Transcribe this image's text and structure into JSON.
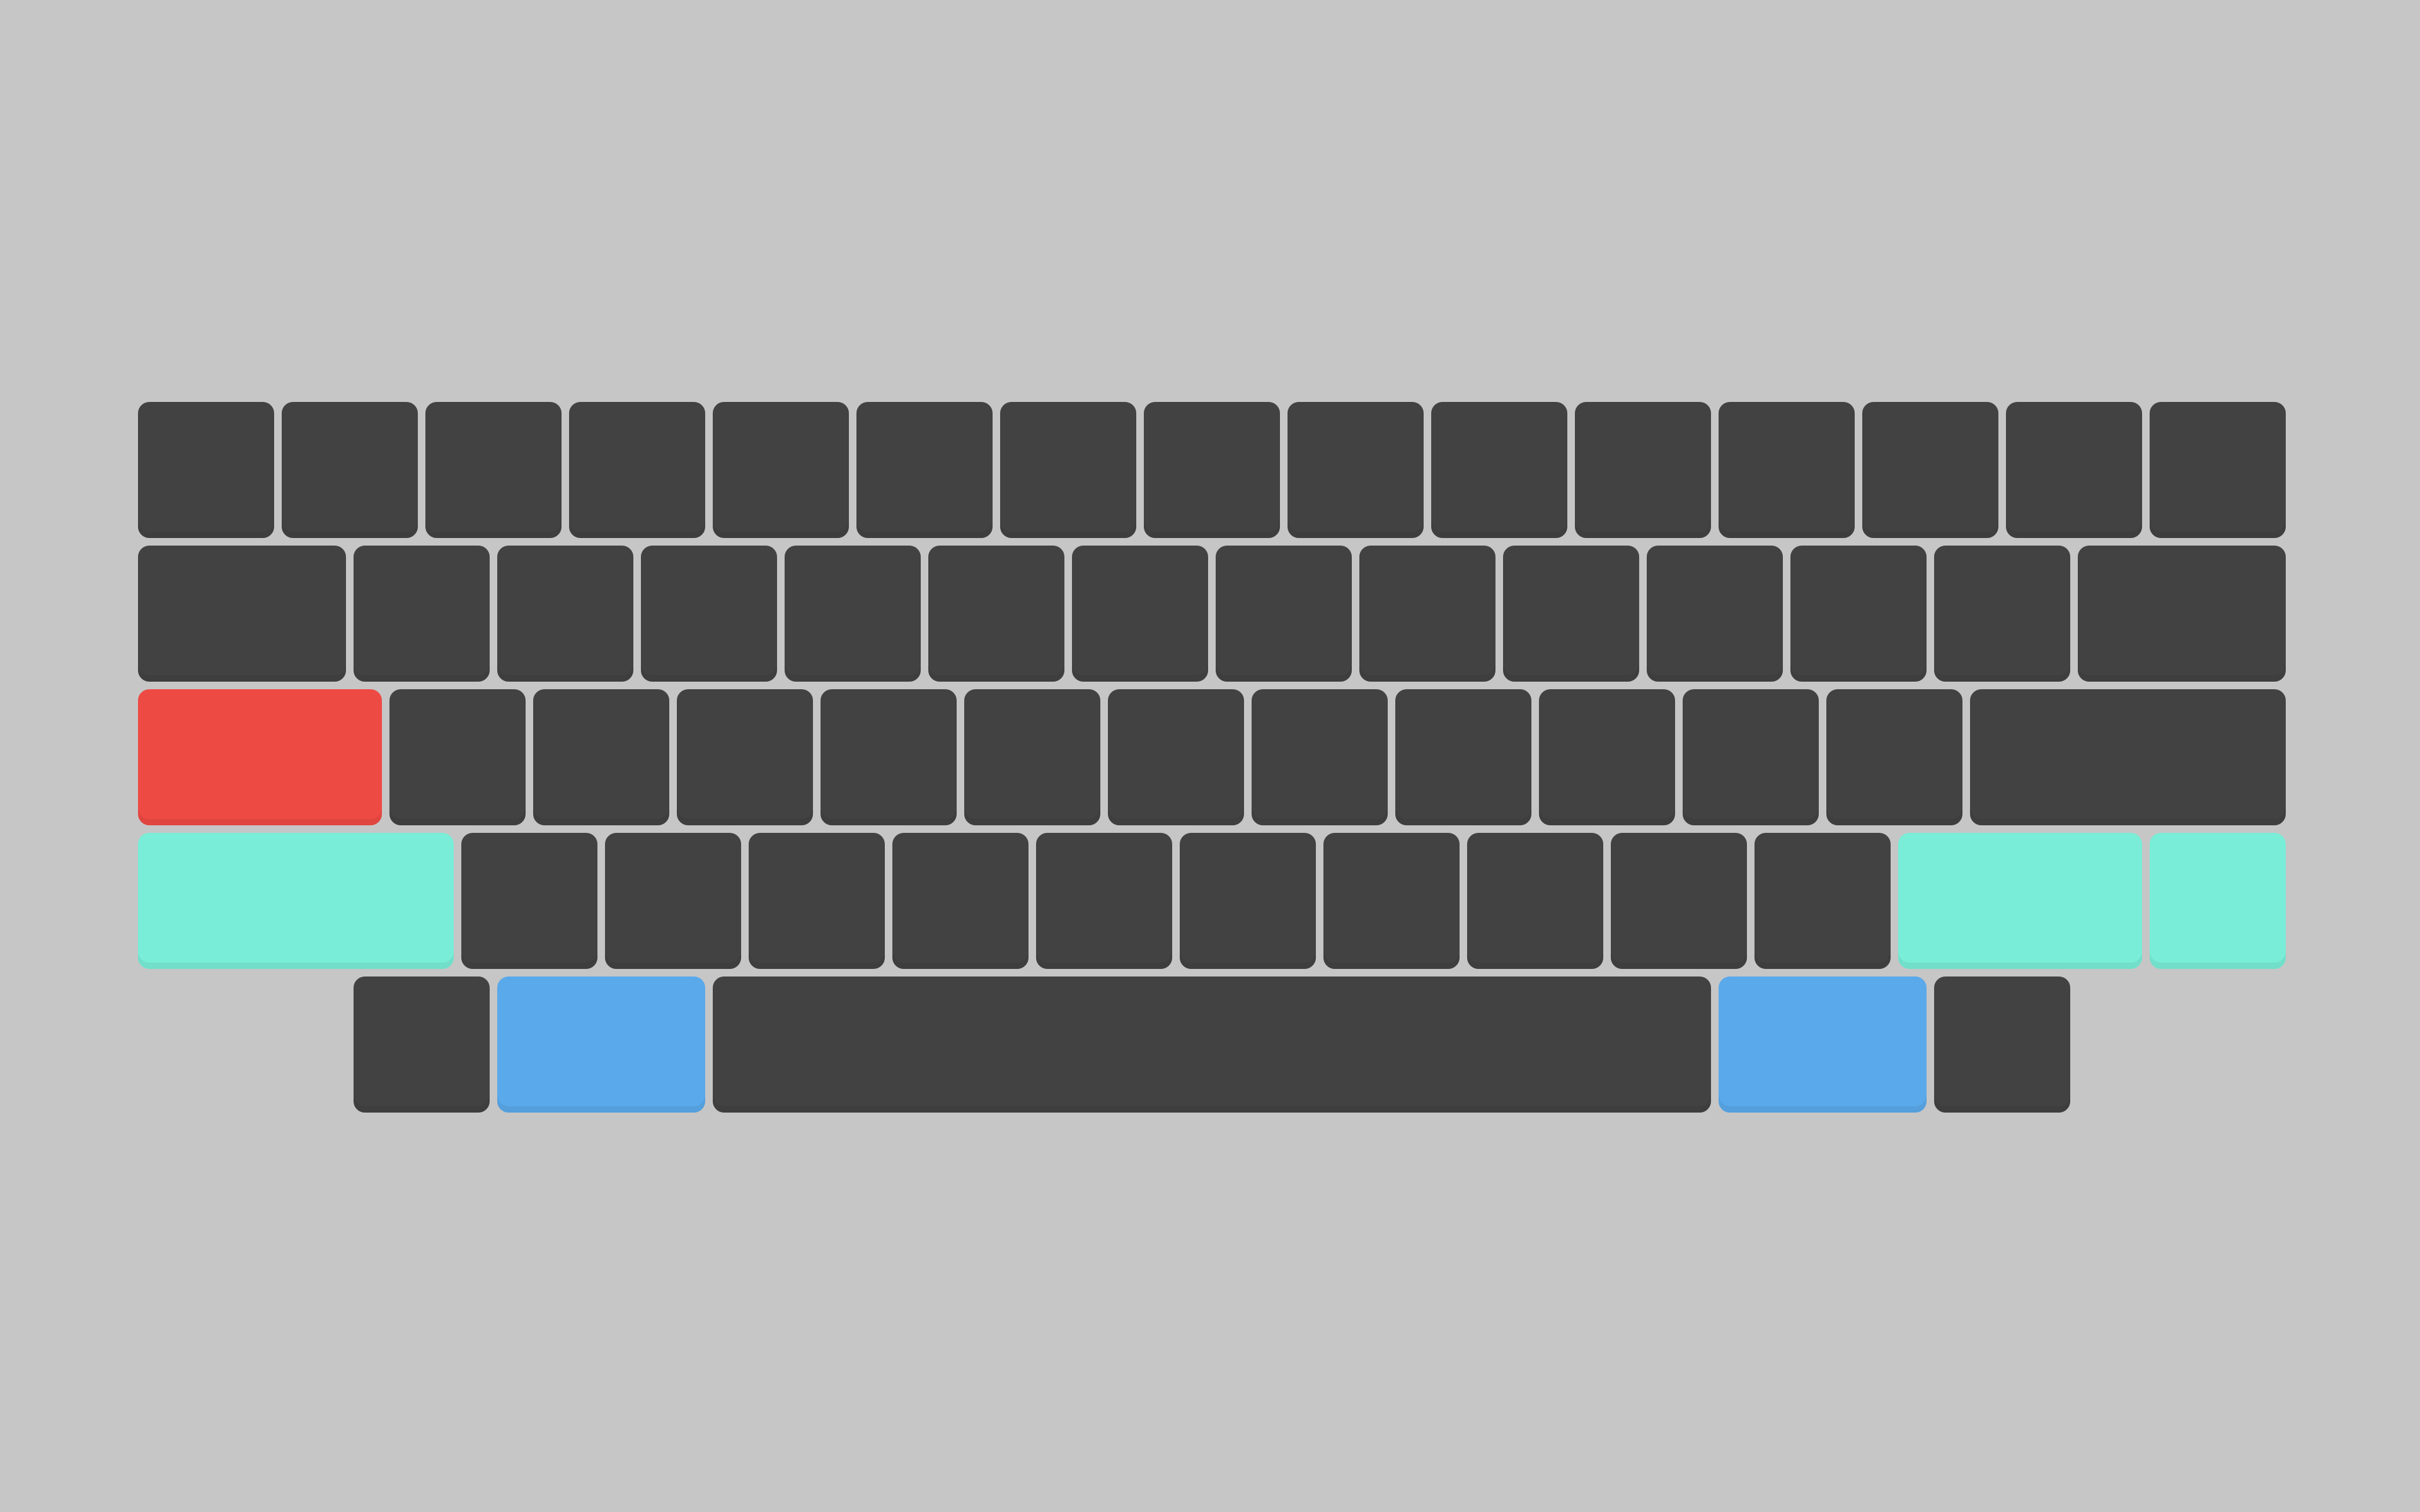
{
  "colors": {
    "background": "#c6c6c6",
    "key": "#424242",
    "red": "#ee4a44",
    "teal": "#79edd7",
    "blue": "#5aa9ea"
  },
  "keyboard": {
    "rows": [
      {
        "name": "number-row",
        "keys": [
          {
            "id": "key-r1-1",
            "units": 1,
            "color": "key"
          },
          {
            "id": "key-r1-2",
            "units": 1,
            "color": "key"
          },
          {
            "id": "key-r1-3",
            "units": 1,
            "color": "key"
          },
          {
            "id": "key-r1-4",
            "units": 1,
            "color": "key"
          },
          {
            "id": "key-r1-5",
            "units": 1,
            "color": "key"
          },
          {
            "id": "key-r1-6",
            "units": 1,
            "color": "key"
          },
          {
            "id": "key-r1-7",
            "units": 1,
            "color": "key"
          },
          {
            "id": "key-r1-8",
            "units": 1,
            "color": "key"
          },
          {
            "id": "key-r1-9",
            "units": 1,
            "color": "key"
          },
          {
            "id": "key-r1-10",
            "units": 1,
            "color": "key"
          },
          {
            "id": "key-r1-11",
            "units": 1,
            "color": "key"
          },
          {
            "id": "key-r1-12",
            "units": 1,
            "color": "key"
          },
          {
            "id": "key-r1-13",
            "units": 1,
            "color": "key"
          },
          {
            "id": "key-r1-14",
            "units": 1,
            "color": "key"
          },
          {
            "id": "key-r1-15",
            "units": 1,
            "color": "key"
          }
        ]
      },
      {
        "name": "top-row",
        "keys": [
          {
            "id": "tab-key",
            "units": 1.5,
            "color": "key"
          },
          {
            "id": "key-r2-2",
            "units": 1,
            "color": "key"
          },
          {
            "id": "key-r2-3",
            "units": 1,
            "color": "key"
          },
          {
            "id": "key-r2-4",
            "units": 1,
            "color": "key"
          },
          {
            "id": "key-r2-5",
            "units": 1,
            "color": "key"
          },
          {
            "id": "key-r2-6",
            "units": 1,
            "color": "key"
          },
          {
            "id": "key-r2-7",
            "units": 1,
            "color": "key"
          },
          {
            "id": "key-r2-8",
            "units": 1,
            "color": "key"
          },
          {
            "id": "key-r2-9",
            "units": 1,
            "color": "key"
          },
          {
            "id": "key-r2-10",
            "units": 1,
            "color": "key"
          },
          {
            "id": "key-r2-11",
            "units": 1,
            "color": "key"
          },
          {
            "id": "key-r2-12",
            "units": 1,
            "color": "key"
          },
          {
            "id": "key-r2-13",
            "units": 1,
            "color": "key"
          },
          {
            "id": "backspace-key",
            "units": 1.5,
            "color": "key"
          }
        ]
      },
      {
        "name": "home-row",
        "keys": [
          {
            "id": "caps-lock-key",
            "units": 1.75,
            "color": "red"
          },
          {
            "id": "key-r3-2",
            "units": 1,
            "color": "key"
          },
          {
            "id": "key-r3-3",
            "units": 1,
            "color": "key"
          },
          {
            "id": "key-r3-4",
            "units": 1,
            "color": "key"
          },
          {
            "id": "key-r3-5",
            "units": 1,
            "color": "key"
          },
          {
            "id": "key-r3-6",
            "units": 1,
            "color": "key"
          },
          {
            "id": "key-r3-7",
            "units": 1,
            "color": "key"
          },
          {
            "id": "key-r3-8",
            "units": 1,
            "color": "key"
          },
          {
            "id": "key-r3-9",
            "units": 1,
            "color": "key"
          },
          {
            "id": "key-r3-10",
            "units": 1,
            "color": "key"
          },
          {
            "id": "key-r3-11",
            "units": 1,
            "color": "key"
          },
          {
            "id": "key-r3-12",
            "units": 1,
            "color": "key"
          },
          {
            "id": "enter-key",
            "units": 2.25,
            "color": "key"
          }
        ]
      },
      {
        "name": "bottom-row",
        "keys": [
          {
            "id": "left-shift-key",
            "units": 2.25,
            "color": "teal"
          },
          {
            "id": "key-r4-2",
            "units": 1,
            "color": "key"
          },
          {
            "id": "key-r4-3",
            "units": 1,
            "color": "key"
          },
          {
            "id": "key-r4-4",
            "units": 1,
            "color": "key"
          },
          {
            "id": "key-r4-5",
            "units": 1,
            "color": "key"
          },
          {
            "id": "key-r4-6",
            "units": 1,
            "color": "key"
          },
          {
            "id": "key-r4-7",
            "units": 1,
            "color": "key"
          },
          {
            "id": "key-r4-8",
            "units": 1,
            "color": "key"
          },
          {
            "id": "key-r4-9",
            "units": 1,
            "color": "key"
          },
          {
            "id": "key-r4-10",
            "units": 1,
            "color": "key"
          },
          {
            "id": "key-r4-11",
            "units": 1,
            "color": "key"
          },
          {
            "id": "right-shift-key",
            "units": 1.75,
            "color": "teal"
          },
          {
            "id": "fn-key",
            "units": 1,
            "color": "teal"
          }
        ]
      },
      {
        "name": "modifier-row",
        "offset_units": 1.5,
        "keys": [
          {
            "id": "left-meta-key",
            "units": 1,
            "color": "key"
          },
          {
            "id": "left-alt-key",
            "units": 1.5,
            "color": "blue"
          },
          {
            "id": "spacebar-key",
            "units": 7,
            "color": "key"
          },
          {
            "id": "right-alt-key",
            "units": 1.5,
            "color": "blue"
          },
          {
            "id": "right-meta-key",
            "units": 1,
            "color": "key"
          }
        ]
      }
    ]
  }
}
